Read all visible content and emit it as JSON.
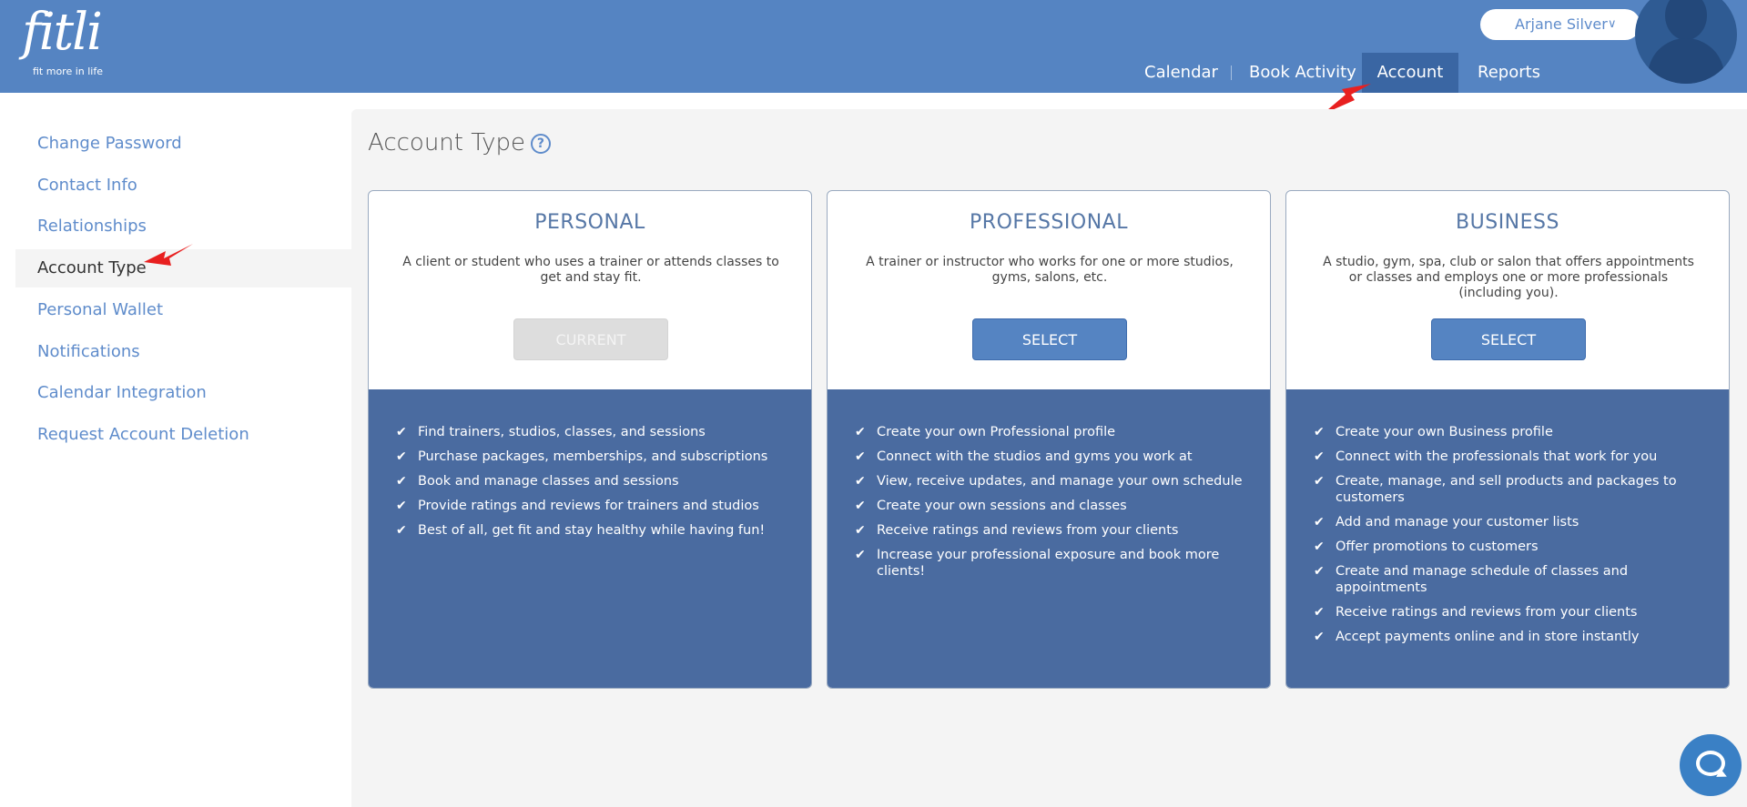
{
  "header": {
    "logo_word": "fitli",
    "logo_tagline": "fit more in life",
    "nav": [
      {
        "label": "Calendar"
      },
      {
        "label": "Book Activity"
      },
      {
        "label": "Account"
      },
      {
        "label": "Reports"
      }
    ],
    "active_nav": "Account",
    "user_name": "Arjane Silver",
    "colors": {
      "header_bg": "#5584c2",
      "active_tab": "#3a66a3"
    }
  },
  "sidebar": {
    "items": [
      {
        "label": "Change Password"
      },
      {
        "label": "Contact Info"
      },
      {
        "label": "Relationships"
      },
      {
        "label": "Account Type"
      },
      {
        "label": "Personal Wallet"
      },
      {
        "label": "Notifications"
      },
      {
        "label": "Calendar Integration"
      },
      {
        "label": "Request Account Deletion"
      }
    ],
    "active_item": "Account Type"
  },
  "main": {
    "title": "Account Type",
    "help_icon": "?",
    "cards": [
      {
        "title": "PERSONAL",
        "description": "A client or student who uses a trainer or attends classes to get and stay fit.",
        "button": "CURRENT",
        "features": [
          "Find trainers, studios, classes, and sessions",
          "Purchase packages, memberships, and subscriptions",
          "Book and manage classes and sessions",
          "Provide ratings and reviews for trainers and studios",
          "Best of all, get fit and stay healthy while having fun!"
        ]
      },
      {
        "title": "PROFESSIONAL",
        "description": "A trainer or instructor who works for one or more studios, gyms, salons, etc.",
        "button": "SELECT",
        "features": [
          "Create your own Professional profile",
          "Connect with the studios and gyms you work at",
          "View, receive updates, and manage your own schedule",
          "Create your own sessions and classes",
          "Receive ratings and reviews from your clients",
          "Increase your professional exposure and book more clients!"
        ]
      },
      {
        "title": "BUSINESS",
        "description": "A studio, gym, spa, club or salon that offers appointments or classes and employs one or more professionals (including you).",
        "button": "SELECT",
        "features": [
          "Create your own Business profile",
          "Connect with the professionals that work for you",
          "Create, manage, and sell products and packages to customers",
          "Add and manage your customer lists",
          "Offer promotions to customers",
          "Create and manage schedule of classes and appointments",
          "Receive ratings and reviews from your clients",
          "Accept payments online and in store instantly"
        ]
      }
    ],
    "check_glyph": "✔",
    "colors": {
      "feature_bg": "#4a6ba0",
      "button_bg": "#5584c2",
      "card_title": "#5677a6"
    }
  },
  "chat": {
    "icon": "chat-bubble-icon"
  }
}
